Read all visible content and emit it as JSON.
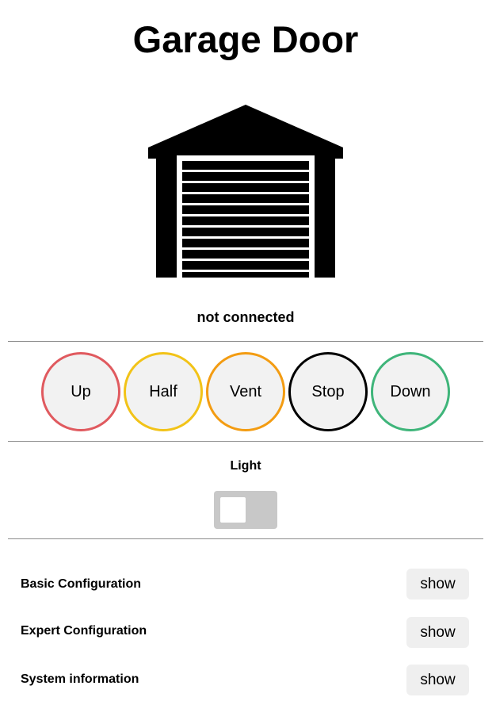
{
  "page": {
    "title": "Garage Door",
    "status": "not connected"
  },
  "icons": {
    "garage": "garage-door-icon"
  },
  "controls": {
    "buttons": [
      {
        "label": "Up",
        "color": "#e05a5f"
      },
      {
        "label": "Half",
        "color": "#f2c318"
      },
      {
        "label": "Vent",
        "color": "#f39c12"
      },
      {
        "label": "Stop",
        "color": "#000000"
      },
      {
        "label": "Down",
        "color": "#3fb57a"
      }
    ]
  },
  "light": {
    "label": "Light",
    "state": "off",
    "toggle_color": "#c8c8c8"
  },
  "config": {
    "rows": [
      {
        "label": "Basic Configuration",
        "button": "show"
      },
      {
        "label": "Expert Configuration",
        "button": "show"
      },
      {
        "label": "System information",
        "button": "show"
      }
    ]
  }
}
